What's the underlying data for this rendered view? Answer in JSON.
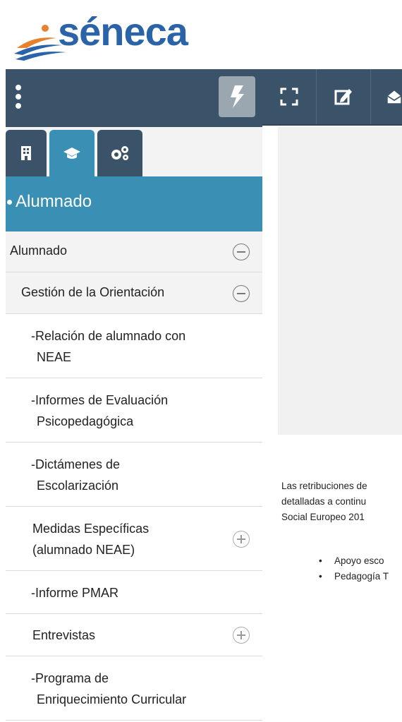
{
  "logo": {
    "text": "séneca"
  },
  "header": {
    "menu_icon": "kebab-icon",
    "quick_access_icon": "bolt-icon"
  },
  "toolbar": {
    "items": [
      {
        "icon": "fullscreen-icon"
      },
      {
        "icon": "edit-icon"
      },
      {
        "icon": "envelope-icon"
      }
    ]
  },
  "tabs": [
    {
      "icon": "building-icon",
      "active": false
    },
    {
      "icon": "graduation-cap-icon",
      "active": true
    },
    {
      "icon": "cogs-icon",
      "active": false
    }
  ],
  "section": {
    "title": "Alumnado"
  },
  "menu": {
    "items": [
      {
        "label": "Alumnado",
        "toggle": "minus"
      },
      {
        "label": "Gestión de la Orientación",
        "toggle": "minus"
      },
      {
        "label_line1": "-Relación de alumnado con",
        "label_line2": "NEAE"
      },
      {
        "label_line1": "-Informes de Evaluación",
        "label_line2": "Psicopedagógica"
      },
      {
        "label_line1": "-Dictámenes de",
        "label_line2": "Escolarización"
      },
      {
        "label_line1": "Medidas Específicas",
        "label_line2": "(alumnado NEAE)",
        "toggle": "plus"
      },
      {
        "label": "-Informe PMAR"
      },
      {
        "label": "Entrevistas",
        "toggle": "plus"
      },
      {
        "label_line1": "-Programa de",
        "label_line2": "Enriquecimiento Curricular"
      }
    ]
  },
  "content": {
    "lines": [
      "Las retribuciones de",
      "detalladas a continu",
      "Social Europeo 201"
    ],
    "bullets": [
      "Apoyo esco",
      "Pedagogía T"
    ]
  },
  "colors": {
    "header_bg": "#3a5368",
    "accent": "#3a8fb4",
    "logo_blue": "#2a63a8",
    "logo_orange": "#e8812e"
  }
}
